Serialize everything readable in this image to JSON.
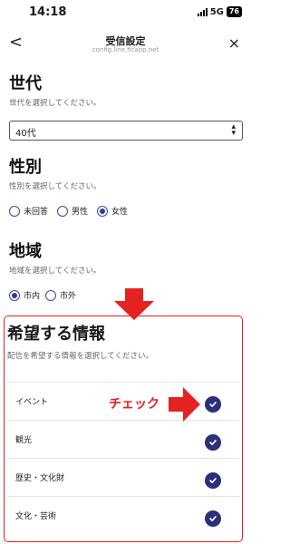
{
  "status": {
    "time": "14:18",
    "network": "5G",
    "battery": "76"
  },
  "nav": {
    "title": "受信設定",
    "subtitle": "config.line.ficapp.net",
    "back_glyph": "<",
    "close_glyph": "×"
  },
  "generation": {
    "title": "世代",
    "desc": "世代を選択してください。",
    "selected": "40代"
  },
  "gender": {
    "title": "性別",
    "desc": "性別を選択してください。",
    "options": [
      {
        "label": "未回答",
        "checked": false
      },
      {
        "label": "男性",
        "checked": false
      },
      {
        "label": "女性",
        "checked": true
      }
    ]
  },
  "region": {
    "title": "地域",
    "desc": "地域を選択してください。",
    "options": [
      {
        "label": "市内",
        "checked": true
      },
      {
        "label": "市外",
        "checked": false
      }
    ]
  },
  "info": {
    "title": "希望する情報",
    "desc": "配信を希望する情報を選択してください。",
    "items": [
      {
        "label": "イベント",
        "checked": true
      },
      {
        "label": "観光",
        "checked": true
      },
      {
        "label": "歴史・文化財",
        "checked": true
      },
      {
        "label": "文化・芸術",
        "checked": true
      }
    ]
  },
  "annotation": {
    "text": "チェック",
    "color": "#e52222"
  },
  "colors": {
    "accent": "#2c2f7a",
    "radio": "#2d3aa0",
    "highlight": "#e52222"
  }
}
